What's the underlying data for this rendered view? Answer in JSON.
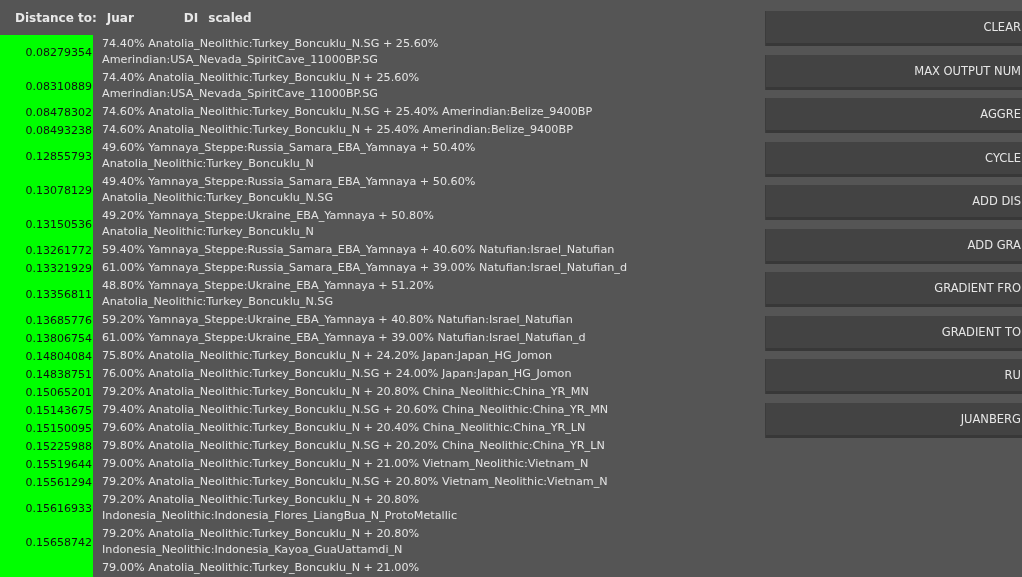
{
  "header": {
    "label": "Distance to:",
    "target_parts": [
      "Juar",
      "DI",
      "scaled"
    ]
  },
  "results": [
    {
      "distance": "0.08279354",
      "lines": [
        "74.40% Anatolia_Neolithic:Turkey_Boncuklu_N.SG + 25.60%",
        "Amerindian:USA_Nevada_SpiritCave_11000BP.SG"
      ]
    },
    {
      "distance": "0.08310889",
      "lines": [
        "74.40% Anatolia_Neolithic:Turkey_Boncuklu_N + 25.60%",
        "Amerindian:USA_Nevada_SpiritCave_11000BP.SG"
      ]
    },
    {
      "distance": "0.08478302",
      "lines": [
        "74.60% Anatolia_Neolithic:Turkey_Boncuklu_N.SG + 25.40% Amerindian:Belize_9400BP"
      ]
    },
    {
      "distance": "0.08493238",
      "lines": [
        "74.60% Anatolia_Neolithic:Turkey_Boncuklu_N + 25.40% Amerindian:Belize_9400BP"
      ]
    },
    {
      "distance": "0.12855793",
      "lines": [
        "49.60% Yamnaya_Steppe:Russia_Samara_EBA_Yamnaya + 50.40%",
        "Anatolia_Neolithic:Turkey_Boncuklu_N"
      ]
    },
    {
      "distance": "0.13078129",
      "lines": [
        "49.40% Yamnaya_Steppe:Russia_Samara_EBA_Yamnaya + 50.60%",
        "Anatolia_Neolithic:Turkey_Boncuklu_N.SG"
      ]
    },
    {
      "distance": "0.13150536",
      "lines": [
        "49.20% Yamnaya_Steppe:Ukraine_EBA_Yamnaya + 50.80%",
        "Anatolia_Neolithic:Turkey_Boncuklu_N"
      ]
    },
    {
      "distance": "0.13261772",
      "lines": [
        "59.40% Yamnaya_Steppe:Russia_Samara_EBA_Yamnaya + 40.60% Natufian:Israel_Natufian"
      ]
    },
    {
      "distance": "0.13321929",
      "lines": [
        "61.00% Yamnaya_Steppe:Russia_Samara_EBA_Yamnaya + 39.00% Natufian:Israel_Natufian_d"
      ]
    },
    {
      "distance": "0.13356811",
      "lines": [
        "48.80% Yamnaya_Steppe:Ukraine_EBA_Yamnaya + 51.20%",
        "Anatolia_Neolithic:Turkey_Boncuklu_N.SG"
      ]
    },
    {
      "distance": "0.13685776",
      "lines": [
        "59.20% Yamnaya_Steppe:Ukraine_EBA_Yamnaya + 40.80% Natufian:Israel_Natufian"
      ]
    },
    {
      "distance": "0.13806754",
      "lines": [
        "61.00% Yamnaya_Steppe:Ukraine_EBA_Yamnaya + 39.00% Natufian:Israel_Natufian_d"
      ]
    },
    {
      "distance": "0.14804084",
      "lines": [
        "75.80% Anatolia_Neolithic:Turkey_Boncuklu_N + 24.20% Japan:Japan_HG_Jomon"
      ]
    },
    {
      "distance": "0.14838751",
      "lines": [
        "76.00% Anatolia_Neolithic:Turkey_Boncuklu_N.SG + 24.00% Japan:Japan_HG_Jomon"
      ]
    },
    {
      "distance": "0.15065201",
      "lines": [
        "79.20% Anatolia_Neolithic:Turkey_Boncuklu_N + 20.80% China_Neolithic:China_YR_MN"
      ]
    },
    {
      "distance": "0.15143675",
      "lines": [
        "79.40% Anatolia_Neolithic:Turkey_Boncuklu_N.SG + 20.60% China_Neolithic:China_YR_MN"
      ]
    },
    {
      "distance": "0.15150095",
      "lines": [
        "79.60% Anatolia_Neolithic:Turkey_Boncuklu_N + 20.40% China_Neolithic:China_YR_LN"
      ]
    },
    {
      "distance": "0.15225988",
      "lines": [
        "79.80% Anatolia_Neolithic:Turkey_Boncuklu_N.SG + 20.20% China_Neolithic:China_YR_LN"
      ]
    },
    {
      "distance": "0.15519644",
      "lines": [
        "79.00% Anatolia_Neolithic:Turkey_Boncuklu_N + 21.00% Vietnam_Neolithic:Vietnam_N"
      ]
    },
    {
      "distance": "0.15561294",
      "lines": [
        "79.20% Anatolia_Neolithic:Turkey_Boncuklu_N.SG + 20.80% Vietnam_Neolithic:Vietnam_N"
      ]
    },
    {
      "distance": "0.15616933",
      "lines": [
        "79.20% Anatolia_Neolithic:Turkey_Boncuklu_N + 20.80%",
        "Indonesia_Neolithic:Indonesia_Flores_LiangBua_N_ProtoMetallic"
      ]
    },
    {
      "distance": "0.15658742",
      "lines": [
        "79.20% Anatolia_Neolithic:Turkey_Boncuklu_N + 20.80%",
        "Indonesia_Neolithic:Indonesia_Kayoa_GuaUattamdi_N"
      ]
    },
    {
      "lines": [
        "79.00% Anatolia_Neolithic:Turkey_Boncuklu_N + 21.00%"
      ]
    }
  ],
  "buttons": [
    "CLEAR",
    "MAX OUTPUT NUM",
    "AGGRE",
    "CYCLE",
    "ADD DIS",
    "ADD GRA",
    "GRADIENT FRO",
    "GRADIENT TO",
    "RU",
    "JUANBERG"
  ]
}
